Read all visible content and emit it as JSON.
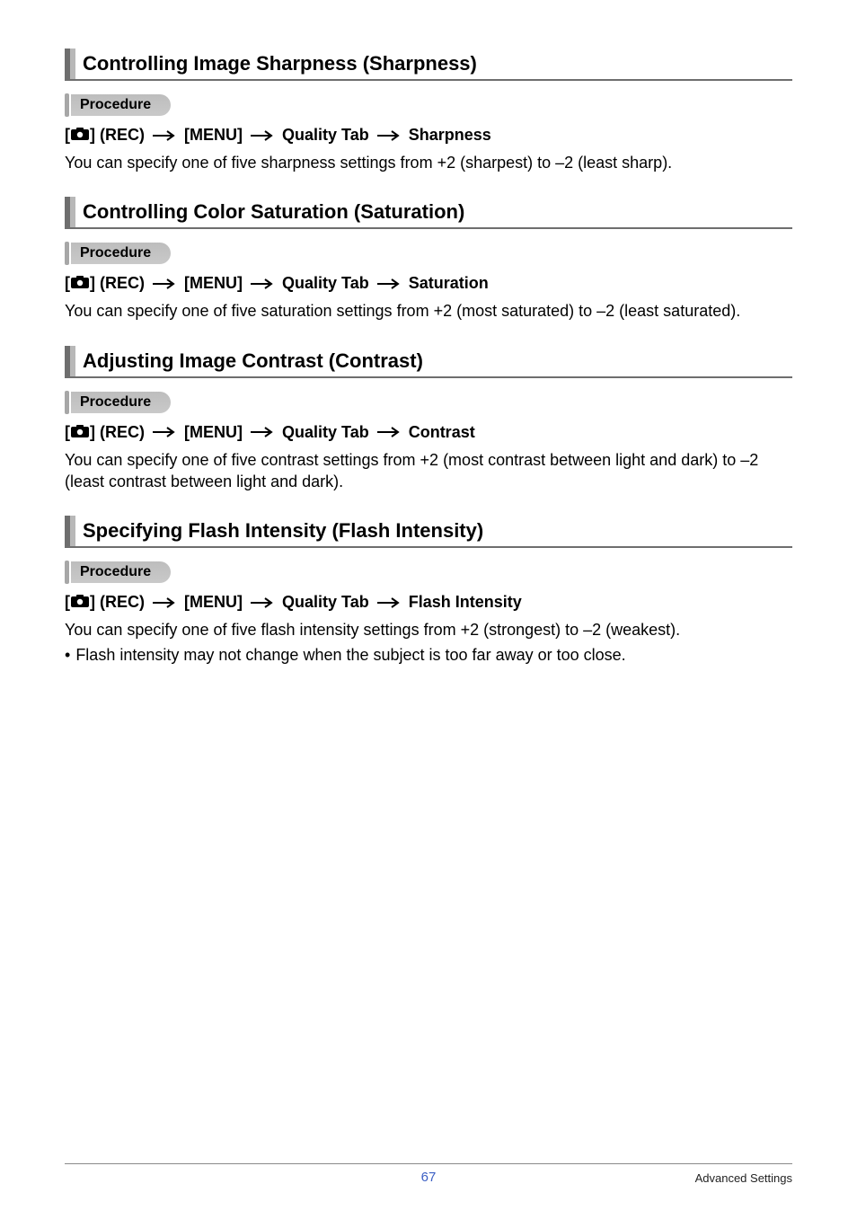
{
  "sections": [
    {
      "heading": "Controlling Image Sharpness (Sharpness)",
      "procedure_label": "Procedure",
      "path": {
        "rec": "(REC)",
        "menu": "[MENU]",
        "tab": "Quality Tab",
        "item": "Sharpness"
      },
      "body": [
        "You can specify one of five sharpness settings from +2 (sharpest) to –2 (least sharp)."
      ],
      "bullets": []
    },
    {
      "heading": "Controlling Color Saturation (Saturation)",
      "procedure_label": "Procedure",
      "path": {
        "rec": "(REC)",
        "menu": "[MENU]",
        "tab": "Quality Tab",
        "item": "Saturation"
      },
      "body": [
        "You can specify one of five saturation settings from +2 (most saturated) to –2 (least saturated)."
      ],
      "bullets": []
    },
    {
      "heading": "Adjusting Image Contrast (Contrast)",
      "procedure_label": "Procedure",
      "path": {
        "rec": "(REC)",
        "menu": "[MENU]",
        "tab": "Quality Tab",
        "item": "Contrast"
      },
      "body": [
        "You can specify one of five contrast settings from +2 (most contrast between light and dark) to –2 (least contrast between light and dark)."
      ],
      "bullets": []
    },
    {
      "heading": "Specifying Flash Intensity (Flash Intensity)",
      "procedure_label": "Procedure",
      "path": {
        "rec": "(REC)",
        "menu": "[MENU]",
        "tab": "Quality Tab",
        "item": "Flash Intensity"
      },
      "body": [
        "You can specify one of five flash intensity settings from +2 (strongest) to –2 (weakest)."
      ],
      "bullets": [
        "Flash intensity may not change when the subject is too far away or too close."
      ]
    }
  ],
  "footer": {
    "page_number": "67",
    "right_text": "Advanced Settings"
  },
  "labels": {
    "left_bracket": "[",
    "right_bracket": "]"
  }
}
